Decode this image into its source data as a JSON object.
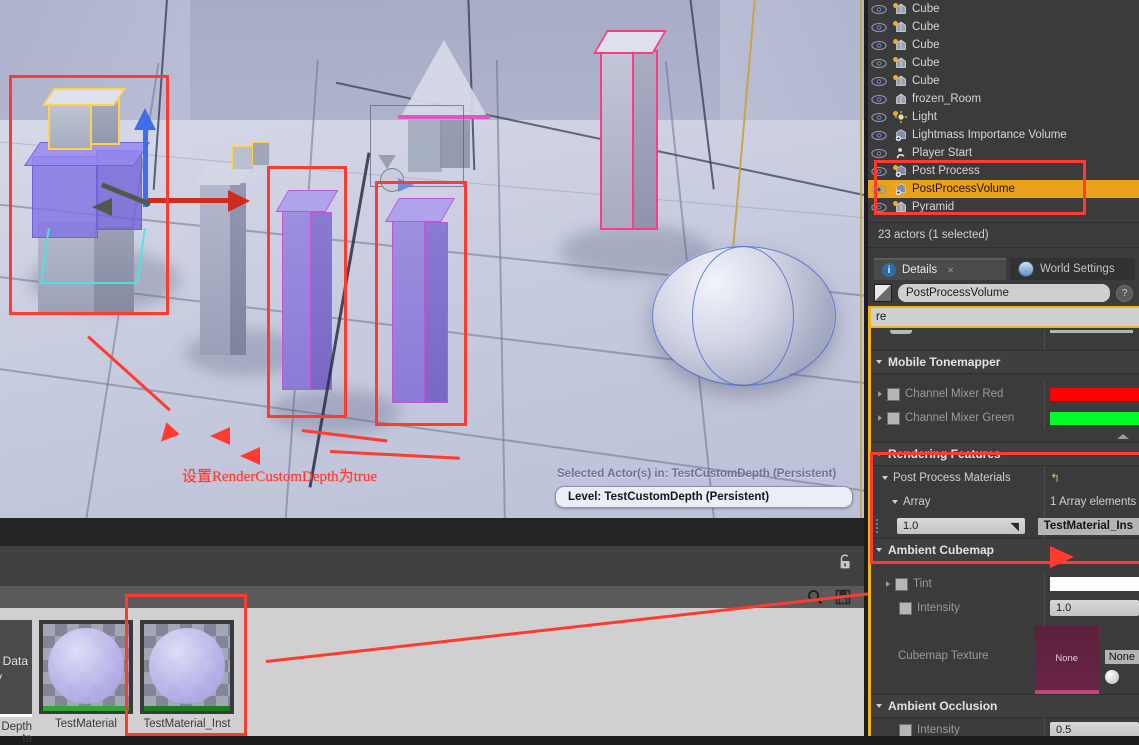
{
  "app": "Unreal Editor",
  "viewport": {
    "selected_actor_label": "Selected Actor(s) in:  TestCustomDepth (Persistent)",
    "level_label": "Level:  TestCustomDepth (Persistent)",
    "annotation_text": "设置RenderCustomDepth为true",
    "annotation_color": "#ff3b30"
  },
  "outliner": {
    "items": [
      {
        "label": "Cube",
        "icon": "mesh-icon",
        "selected": false,
        "modified": true
      },
      {
        "label": "Cube",
        "icon": "mesh-icon",
        "selected": false,
        "modified": true
      },
      {
        "label": "Cube",
        "icon": "mesh-icon",
        "selected": false,
        "modified": true
      },
      {
        "label": "Cube",
        "icon": "mesh-icon",
        "selected": false,
        "modified": true
      },
      {
        "label": "Cube",
        "icon": "mesh-icon",
        "selected": false,
        "modified": true
      },
      {
        "label": "frozen_Room",
        "icon": "mesh-icon",
        "selected": false,
        "modified": false
      },
      {
        "label": "Light",
        "icon": "light-icon",
        "selected": false,
        "modified": true
      },
      {
        "label": "Lightmass Importance Volume",
        "icon": "volume-icon",
        "selected": false,
        "modified": false
      },
      {
        "label": "Player Start",
        "icon": "player-start-icon",
        "selected": false,
        "modified": false
      },
      {
        "label": "Post Process",
        "icon": "volume-icon",
        "selected": false,
        "modified": true
      },
      {
        "label": "PostProcessVolume",
        "icon": "volume-icon",
        "selected": true,
        "modified": true
      },
      {
        "label": "Pyramid",
        "icon": "mesh-icon",
        "selected": false,
        "modified": true
      }
    ],
    "status": "23 actors (1 selected)"
  },
  "details": {
    "tabs": [
      {
        "label": "Details",
        "icon": "info-icon",
        "active": true,
        "closable": true
      },
      {
        "label": "World Settings",
        "icon": "globe-icon",
        "active": false,
        "closable": false
      }
    ],
    "close_glyph": "×",
    "help_glyph": "?",
    "object_name": "PostProcessVolume",
    "search_value": "re",
    "sections": [
      {
        "title": "Mobile Tonemapper",
        "rows": [
          {
            "label": "Channel Mixer Red",
            "type": "color",
            "color": "#ff0000",
            "checkbox": true,
            "expandable": true,
            "dim": true
          },
          {
            "label": "Channel Mixer Green",
            "type": "color",
            "color": "#00ff2a",
            "checkbox": true,
            "expandable": true,
            "dim": true
          }
        ]
      },
      {
        "title": "Rendering Features",
        "rows": [
          {
            "label": "Post Process Materials",
            "type": "reset",
            "reset_glyph": "↰",
            "expandable": true,
            "dim": false
          },
          {
            "label": "Array",
            "type": "text",
            "value": "1 Array elements",
            "expandable": true,
            "dim": false
          },
          {
            "label": "1.0",
            "type": "array-element",
            "value": "TestMaterial_Ins",
            "dim": false
          }
        ]
      },
      {
        "title": "Ambient Cubemap",
        "rows": [
          {
            "label": "Tint",
            "type": "white",
            "checkbox": true,
            "expandable": true,
            "dim": true
          },
          {
            "label": "Intensity",
            "type": "number",
            "value": "1.0",
            "checkbox": true,
            "dim": true
          },
          {
            "label": "Cubemap Texture",
            "type": "thumbnail",
            "value": "None",
            "thumb_label": "None",
            "dim": false
          }
        ]
      },
      {
        "title": "Ambient Occlusion",
        "rows": [
          {
            "label": "Intensity",
            "type": "number",
            "value": "0.5",
            "checkbox": true,
            "dim": true
          }
        ]
      }
    ]
  },
  "content_browser": {
    "lock_icon": "lock-icon",
    "search_icon": "search-icon",
    "save_icon": "save-icon",
    "assets": [
      {
        "label": "TestMaterial",
        "bar_color": "#2fa832",
        "selected": false,
        "partial": false
      },
      {
        "label": "TestMaterial_Inst",
        "bar_color": "#1d7a1f",
        "selected": true,
        "partial": false
      }
    ],
    "partial_asset": {
      "line1": "Data",
      "line2": "y",
      "label1": "Depth",
      "label2": "ta"
    }
  }
}
